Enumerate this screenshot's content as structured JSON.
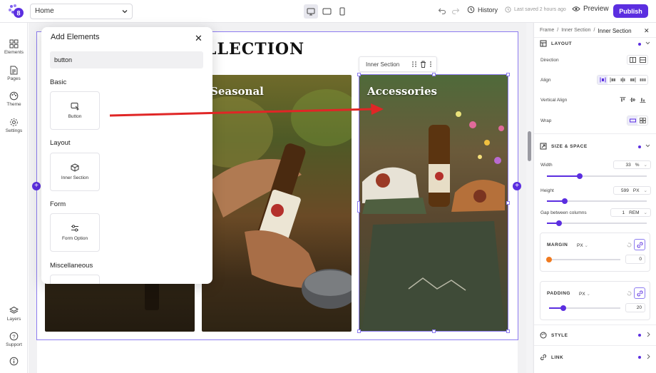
{
  "header": {
    "page_select": "Home",
    "history_label": "History",
    "saved_status": "Last saved 2 hours ago",
    "preview_label": "Preview",
    "publish_label": "Publish",
    "accent": "#5b2ee0"
  },
  "rail": {
    "items": [
      {
        "label": "Elements",
        "icon": "grid-icon"
      },
      {
        "label": "Pages",
        "icon": "page-icon"
      },
      {
        "label": "Theme",
        "icon": "palette-icon"
      },
      {
        "label": "Settings",
        "icon": "gear-icon"
      }
    ],
    "bottom": [
      {
        "label": "Layers",
        "icon": "layers-icon"
      },
      {
        "label": "Support",
        "icon": "help-icon"
      }
    ]
  },
  "canvas": {
    "heading_fragment": "LLECTION",
    "cards": [
      {
        "title": ""
      },
      {
        "title": "Seasonal"
      },
      {
        "title": "Accessories"
      }
    ],
    "inner_toolbar_label": "Inner Section"
  },
  "add_panel": {
    "title": "Add Elements",
    "search_value": "button",
    "sections": [
      {
        "label": "Basic",
        "tiles": [
          "Button"
        ]
      },
      {
        "label": "Layout",
        "tiles": [
          "Inner Section"
        ]
      },
      {
        "label": "Form",
        "tiles": [
          "Form Option"
        ]
      },
      {
        "label": "Miscellaneous",
        "tiles": []
      }
    ]
  },
  "right_panel": {
    "breadcrumb": [
      "Frame",
      "Inner Section",
      "Inner Section"
    ],
    "layout": {
      "title": "LAYOUT",
      "direction_label": "Direction",
      "align_label": "Align",
      "valign_label": "Vertical Align",
      "wrap_label": "Wrap"
    },
    "size_space": {
      "title": "SIZE & SPACE",
      "width_label": "Width",
      "width_value": "33",
      "width_unit": "%",
      "width_level": 0.33,
      "height_label": "Height",
      "height_value": "599",
      "height_unit": "PX",
      "height_level": 0.18,
      "gap_label": "Gap between columns",
      "gap_value": "1",
      "gap_unit": "REM",
      "gap_level": 0.12,
      "margin_label": "MARGIN",
      "margin_unit": "PX",
      "margin_value": "0",
      "margin_level": 0.0,
      "padding_label": "PADDING",
      "padding_unit": "PX",
      "padding_value": "20",
      "padding_level": 0.2
    },
    "style_title": "STYLE",
    "link_title": "LINK"
  }
}
